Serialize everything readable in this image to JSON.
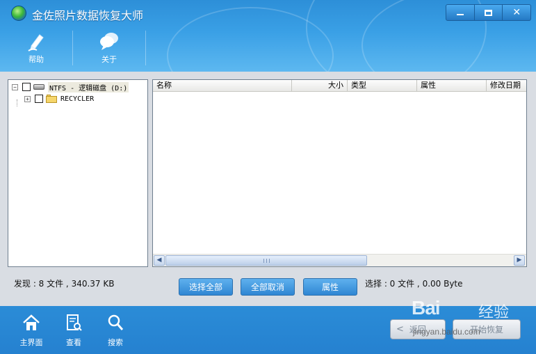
{
  "window": {
    "title": "金佐照片数据恢复大师",
    "controls": {
      "minimize": "minimize-icon",
      "maximize": "maximize-icon",
      "close": "✕"
    }
  },
  "toolbar": {
    "items": [
      {
        "label": "帮助",
        "icon": "help-pen-icon"
      },
      {
        "label": "关于",
        "icon": "about-bubble-icon"
      }
    ]
  },
  "tree": {
    "root": {
      "expander": "−",
      "label": "NTFS - 逻辑磁盘 (D:)",
      "icon": "drive-icon",
      "checked": false
    },
    "children": [
      {
        "expander": "+",
        "label": "RECYCLER",
        "icon": "folder-icon",
        "checked": false
      }
    ]
  },
  "file_list": {
    "columns": [
      {
        "label": "名称",
        "align": "left"
      },
      {
        "label": "大小",
        "align": "right"
      },
      {
        "label": "类型",
        "align": "left"
      },
      {
        "label": "属性",
        "align": "left"
      },
      {
        "label": "修改日期",
        "align": "left"
      }
    ],
    "rows": [],
    "scroll_left_glyph": "◀",
    "scroll_right_glyph": "▶"
  },
  "status": {
    "found": "发现 : 8 文件 , 340.37 KB",
    "selected": "选择 : 0 文件 , 0.00 Byte"
  },
  "actions": {
    "select_all": "选择全部",
    "deselect_all": "全部取消",
    "properties": "属性"
  },
  "footer": {
    "nav": [
      {
        "label": "主界面",
        "icon": "home-icon"
      },
      {
        "label": "查看",
        "icon": "document-view-icon"
      },
      {
        "label": "搜索",
        "icon": "search-icon"
      }
    ],
    "back": {
      "label": "返回",
      "glyph": "<"
    },
    "recover": {
      "label": "开始恢复"
    }
  },
  "watermark": {
    "logo": "Bai",
    "logo_suffix": "经验",
    "url": "jingyan.baidu.com"
  },
  "colors": {
    "header": "#3aa0e6",
    "footer": "#2581d0",
    "action_button": "#2f86d3",
    "pane_background": "#ffffff"
  }
}
